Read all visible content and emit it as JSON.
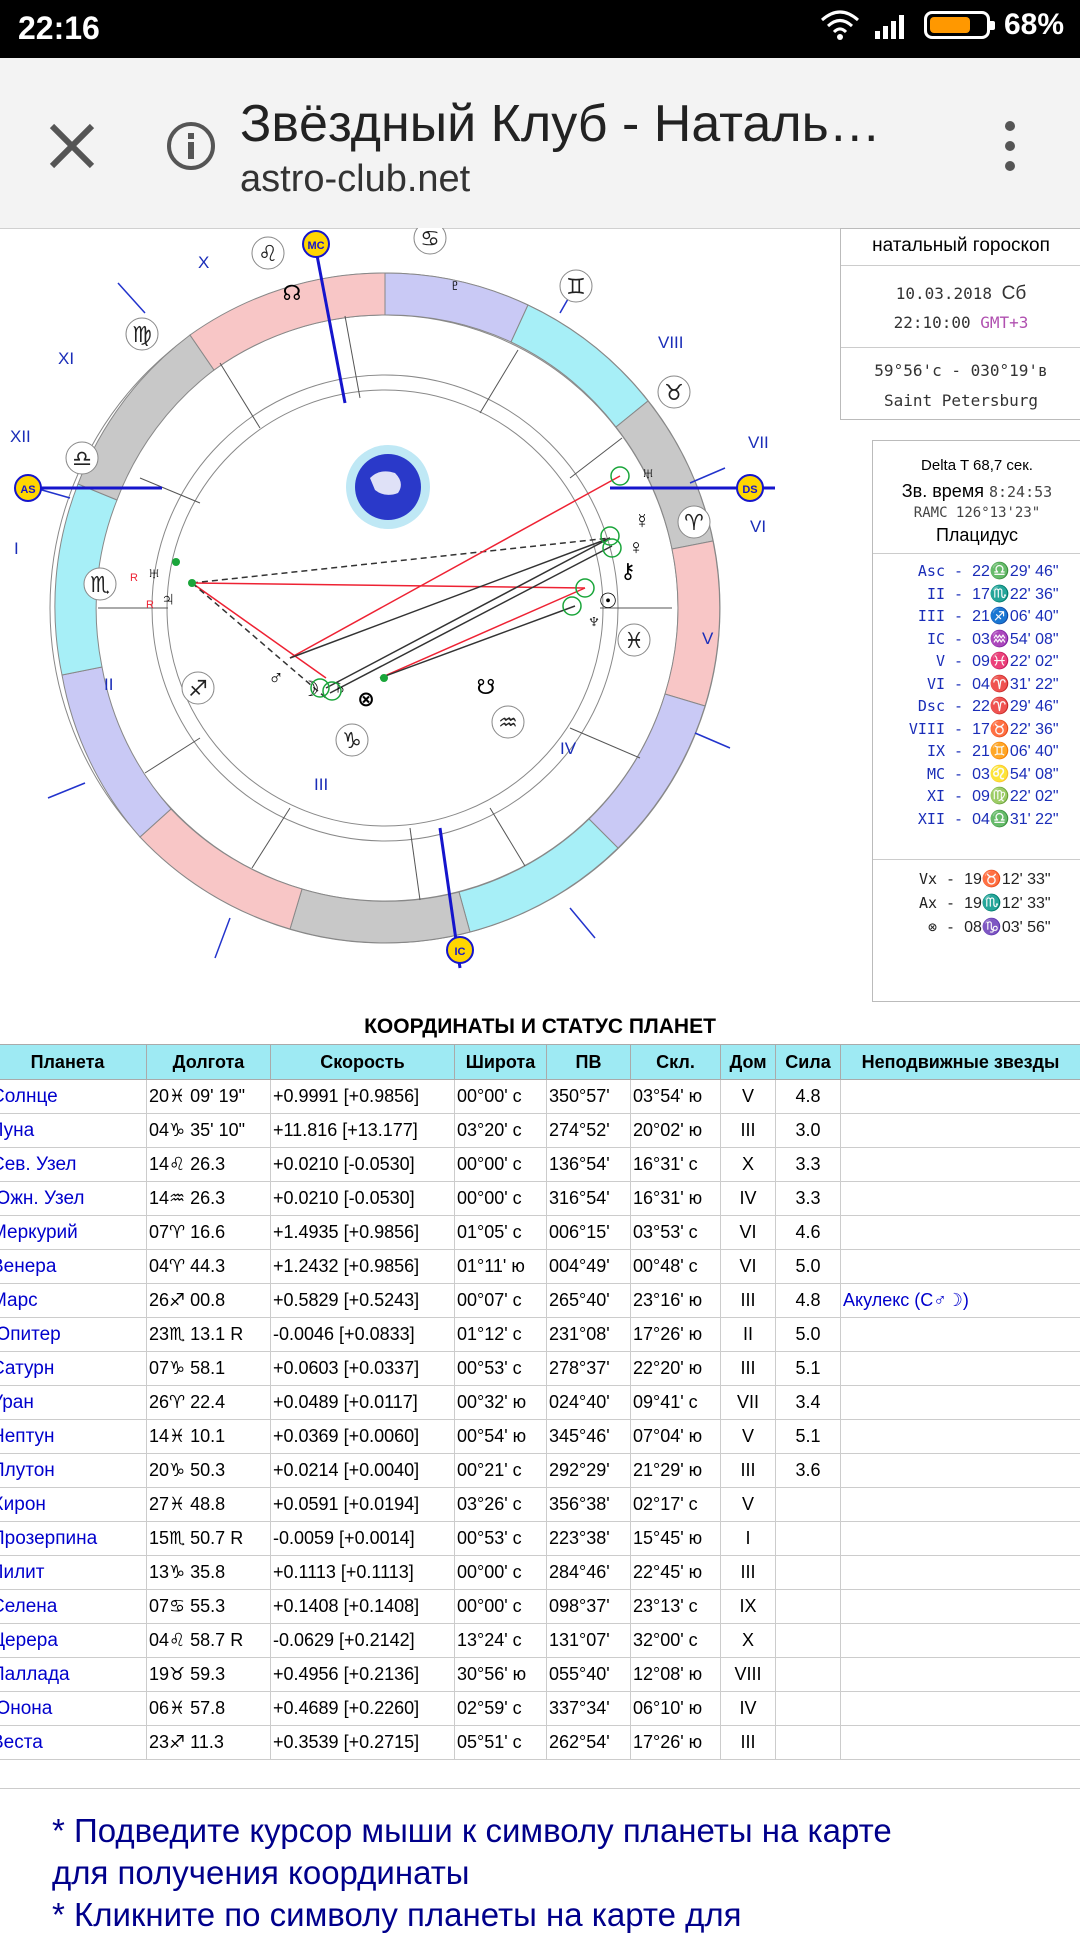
{
  "status_bar": {
    "time": "22:16",
    "battery": "68%"
  },
  "browser": {
    "title": "Звёздный Клуб - Наталь…",
    "url": "astro-club.net"
  },
  "chart": {
    "mc": "MC",
    "ic": "IC",
    "asc": "AS",
    "dsc": "DS",
    "house_numerals": [
      "X",
      "VIII",
      "XI",
      "VII",
      "XII",
      "VI",
      "I",
      "V",
      "II",
      "IV",
      "III"
    ],
    "signs": [
      "♌",
      "♋",
      "♊",
      "♉",
      "♈",
      "♓",
      "♒",
      "♑",
      "♐",
      "♏",
      "♎",
      "♍"
    ],
    "planets": [
      "☊",
      "♇",
      "♅",
      "☿",
      "♀",
      "⚷",
      "☉",
      "♆",
      "♄",
      "☽",
      "⊗",
      "♂",
      "♃",
      "♅",
      "☋"
    ],
    "retro": "R"
  },
  "info1": {
    "title": "натальный гороскоп",
    "date": "10.03.2018",
    "day": "Сб",
    "time": "22:10:00",
    "gmt": "GMT+3",
    "coords": "59°56'с - 030°19'в",
    "city": "Saint Petersburg"
  },
  "info2": {
    "delta_t_label": "Delta T",
    "delta_t": "68,7 сек.",
    "sid_label": "Зв. время",
    "sid": "8:24:53",
    "ramc": "RAMC 126°13'23\"",
    "system": "Плацидус",
    "cusps": [
      [
        "Asc",
        "22♎29' 46\""
      ],
      [
        "II",
        "17♏22' 36\""
      ],
      [
        "III",
        "21♐06' 40\""
      ],
      [
        "IC",
        "03♒54' 08\""
      ],
      [
        "V",
        "09♓22' 02\""
      ],
      [
        "VI",
        "04♈31' 22\""
      ],
      [
        "Dsc",
        "22♈29' 46\""
      ],
      [
        "VIII",
        "17♉22' 36\""
      ],
      [
        "IX",
        "21♊06' 40\""
      ],
      [
        "MC",
        "03♌54' 08\""
      ],
      [
        "XI",
        "09♍22' 02\""
      ],
      [
        "XII",
        "04♎31' 22\""
      ]
    ],
    "points": [
      [
        "Vx",
        "19♉12' 33\""
      ],
      [
        "Ax",
        "19♏12' 33\""
      ],
      [
        "⊗",
        "08♑03' 56\""
      ]
    ]
  },
  "table": {
    "title": "КООРДИНАТЫ И СТАТУС ПЛАНЕТ",
    "headers": [
      "Планета",
      "Долгота",
      "Скорость",
      "Широта",
      "ПВ",
      "Скл.",
      "Дом",
      "Сила",
      "Неподвижные звезды"
    ],
    "rows": [
      [
        "Солнце",
        "20♓ 09' 19\"",
        "+0.9991 [+0.9856]",
        "00°00' с",
        "350°57'",
        "03°54' ю",
        "V",
        "4.8",
        ""
      ],
      [
        "Луна",
        "04♑ 35' 10\"",
        "+11.816 [+13.177]",
        "03°20' с",
        "274°52'",
        "20°02' ю",
        "III",
        "3.0",
        ""
      ],
      [
        "Сев. Узел",
        "14♌ 26.3",
        "+0.0210 [-0.0530]",
        "00°00' с",
        "136°54'",
        "16°31' с",
        "X",
        "3.3",
        ""
      ],
      [
        "Южн. Узел",
        "14♒ 26.3",
        "+0.0210 [-0.0530]",
        "00°00' с",
        "316°54'",
        "16°31' ю",
        "IV",
        "3.3",
        ""
      ],
      [
        "Меркурий",
        "07♈ 16.6",
        "+1.4935 [+0.9856]",
        "01°05' с",
        "006°15'",
        "03°53' с",
        "VI",
        "4.6",
        ""
      ],
      [
        "Венера",
        "04♈ 44.3",
        "+1.2432 [+0.9856]",
        "01°11' ю",
        "004°49'",
        "00°48' с",
        "VI",
        "5.0",
        ""
      ],
      [
        "Марс",
        "26♐ 00.8",
        "+0.5829 [+0.5243]",
        "00°07' с",
        "265°40'",
        "23°16' ю",
        "III",
        "4.8",
        "Акулекс (С♂☽)"
      ],
      [
        "Юпитер",
        "23♏ 13.1  R",
        "-0.0046 [+0.0833]",
        "01°12' с",
        "231°08'",
        "17°26' ю",
        "II",
        "5.0",
        ""
      ],
      [
        "Сатурн",
        "07♑ 58.1",
        "+0.0603 [+0.0337]",
        "00°53' с",
        "278°37'",
        "22°20' ю",
        "III",
        "5.1",
        ""
      ],
      [
        "Уран",
        "26♈ 22.4",
        "+0.0489 [+0.0117]",
        "00°32' ю",
        "024°40'",
        "09°41' с",
        "VII",
        "3.4",
        ""
      ],
      [
        "Нептун",
        "14♓ 10.1",
        "+0.0369 [+0.0060]",
        "00°54' ю",
        "345°46'",
        "07°04' ю",
        "V",
        "5.1",
        ""
      ],
      [
        "Плутон",
        "20♑ 50.3",
        "+0.0214 [+0.0040]",
        "00°21' с",
        "292°29'",
        "21°29' ю",
        "III",
        "3.6",
        ""
      ],
      [
        "Хирон",
        "27♓ 48.8",
        "+0.0591 [+0.0194]",
        "03°26' с",
        "356°38'",
        "02°17' с",
        "V",
        "",
        ""
      ],
      [
        "Прозерпина",
        "15♏ 50.7  R",
        "-0.0059 [+0.0014]",
        "00°53' с",
        "223°38'",
        "15°45' ю",
        "I",
        "",
        ""
      ],
      [
        "Лилит",
        "13♑ 35.8",
        "+0.1113 [+0.1113]",
        "00°00' с",
        "284°46'",
        "22°45' ю",
        "III",
        "",
        ""
      ],
      [
        "Селена",
        "07♋ 55.3",
        "+0.1408 [+0.1408]",
        "00°00' с",
        "098°37'",
        "23°13' с",
        "IX",
        "",
        ""
      ],
      [
        "Церера",
        "04♌ 58.7  R",
        "-0.0629 [+0.2142]",
        "13°24' с",
        "131°07'",
        "32°00' с",
        "X",
        "",
        ""
      ],
      [
        "Паллада",
        "19♉ 59.3",
        "+0.4956 [+0.2136]",
        "30°56' ю",
        "055°40'",
        "12°08' ю",
        "VIII",
        "",
        ""
      ],
      [
        "Юнона",
        "06♓ 57.8",
        "+0.4689 [+0.2260]",
        "02°59' с",
        "337°34'",
        "06°10' ю",
        "IV",
        "",
        ""
      ],
      [
        "Веста",
        "23♐ 11.3",
        "+0.3539 [+0.2715]",
        "05°51' с",
        "262°54'",
        "17°26' ю",
        "III",
        "",
        ""
      ]
    ]
  },
  "notes": {
    "line1": " * Подведите курсор мыши к символу планеты на карте",
    "line2": "для получения координаты",
    "line3": " * Кликните по символу планеты на карте для"
  }
}
